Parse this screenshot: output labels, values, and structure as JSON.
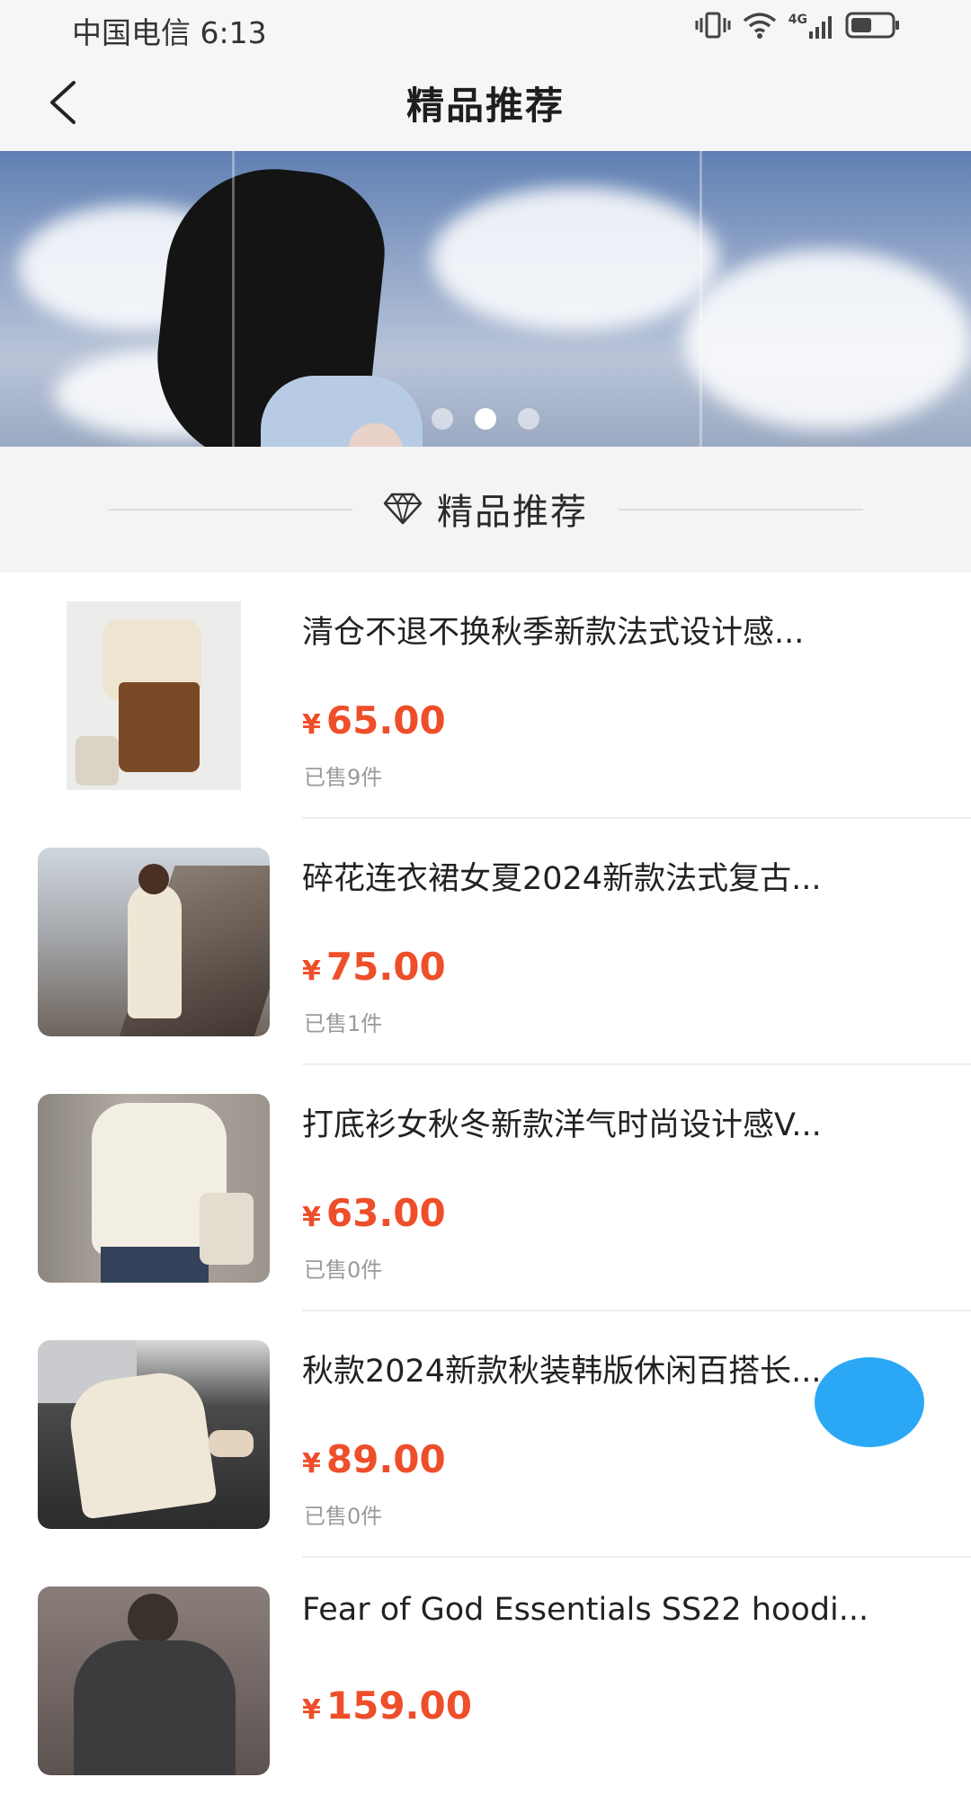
{
  "status_bar": {
    "carrier_time": "中国电信 6:13",
    "network_label": "4G"
  },
  "nav": {
    "title": "精品推荐"
  },
  "banner": {
    "dots": 3,
    "active_index": 1
  },
  "section": {
    "title": "精品推荐"
  },
  "products": [
    {
      "title": "清仓不退不换秋季新款法式设计感...",
      "currency": "¥",
      "price": "65.00",
      "sold": "已售9件"
    },
    {
      "title": "碎花连衣裙女夏2024新款法式复古...",
      "currency": "¥",
      "price": "75.00",
      "sold": "已售1件"
    },
    {
      "title": "打底衫女秋冬新款洋气时尚设计感V...",
      "currency": "¥",
      "price": "63.00",
      "sold": "已售0件"
    },
    {
      "title": "秋款2024新款秋装韩版休闲百搭长...",
      "currency": "¥",
      "price": "89.00",
      "sold": "已售0件"
    },
    {
      "title": "Fear of God Essentials SS22 hoodi...",
      "currency": "¥",
      "price": "159.00",
      "sold": ""
    }
  ],
  "colors": {
    "accent_price": "#ee4e2a",
    "float_button": "#2aa8f5"
  }
}
